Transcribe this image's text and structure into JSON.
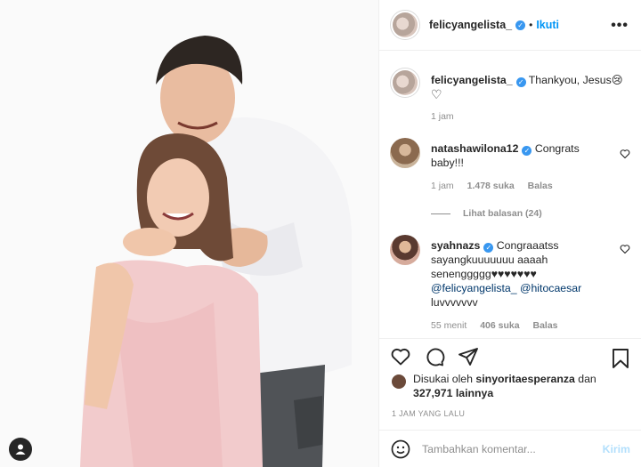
{
  "post": {
    "username": "felicyangelista_",
    "follow_label": "Ikuti",
    "more_label": "•••"
  },
  "caption": {
    "username": "felicyangelista_",
    "text": "Thankyou, Jesus😢",
    "second_line": "♡",
    "time": "1 jam"
  },
  "comments": [
    {
      "username": "natashawilona12",
      "text": "Congrats baby!!!",
      "time": "1 jam",
      "likes": "1.478 suka",
      "reply": "Balas",
      "view_replies": "Lihat balasan (24)"
    },
    {
      "username": "syahnazs",
      "text": "Congraaatss sayangkuuuuuuu aaaah senenggggg♥♥♥♥♥♥♥",
      "mention1": "@felicyangelista_",
      "mention2": "@hitocaesar",
      "tail": "luvvvvvvv",
      "time": "55 menit",
      "likes": "406 suka",
      "reply": "Balas"
    }
  ],
  "likes": {
    "prefix": "Disukai oleh",
    "user": "sinyoritaesperanza",
    "connector": "dan",
    "count": "327,971 lainnya"
  },
  "timestamp": "1 JAM YANG LALU",
  "composer": {
    "placeholder": "Tambahkan komentar...",
    "send_label": "Kirim"
  },
  "icons": [
    "user-tag-icon",
    "verified-icon",
    "heart-icon",
    "comment-icon",
    "share-icon",
    "bookmark-icon",
    "emoji-icon"
  ],
  "colors": {
    "link": "#0095f6",
    "verified": "#3897f0",
    "muted": "#8e8e8e",
    "send_disabled": "#b2dffc"
  }
}
